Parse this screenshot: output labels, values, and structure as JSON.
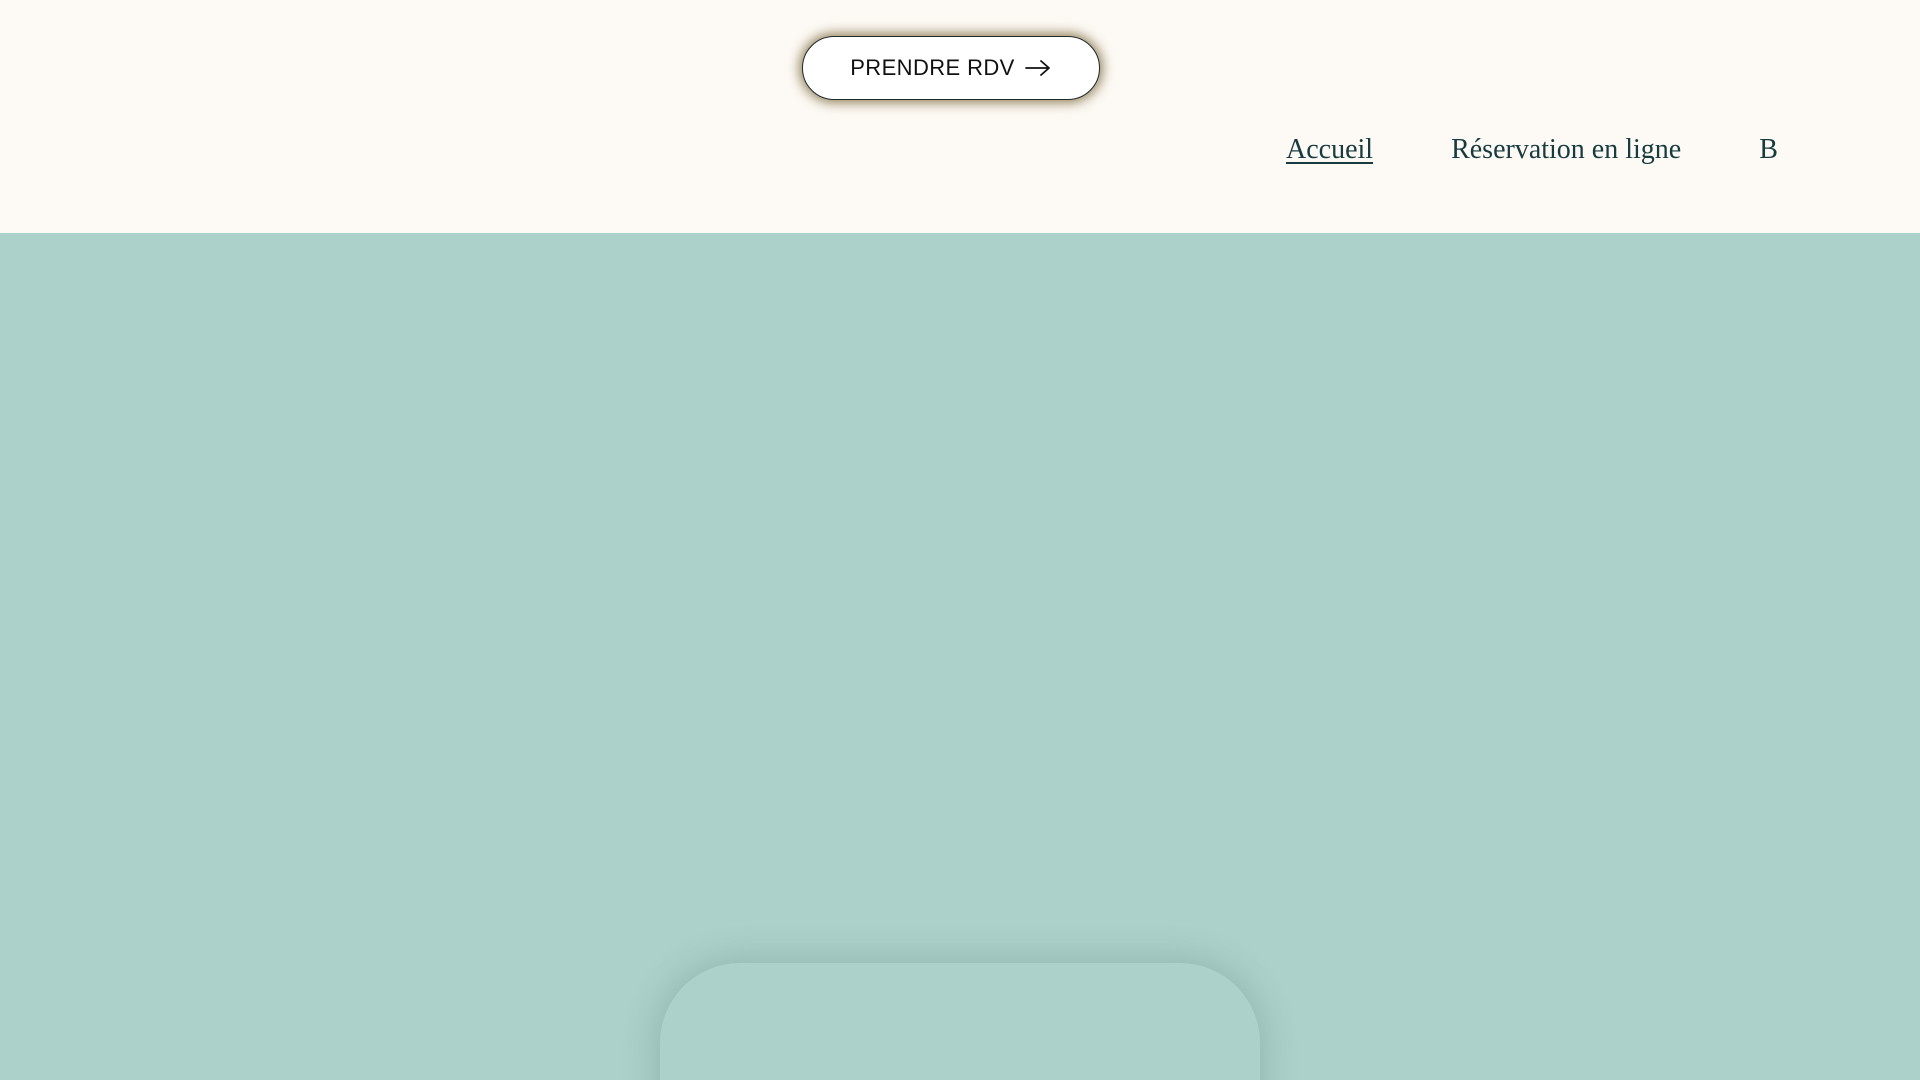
{
  "header": {
    "cta": {
      "label": "PRENDRE RDV",
      "icon": "arrow-right-icon"
    },
    "nav": {
      "items": [
        {
          "label": "Accueil",
          "active": true
        },
        {
          "label": "Réservation en ligne",
          "active": false
        },
        {
          "label": "Blog",
          "active": false
        }
      ]
    }
  },
  "colors": {
    "header_background": "#fdf9f4",
    "hero_background": "#acd0ca",
    "nav_text": "#173b3f",
    "button_background": "#ffffff",
    "button_border": "#1f2a2b"
  }
}
